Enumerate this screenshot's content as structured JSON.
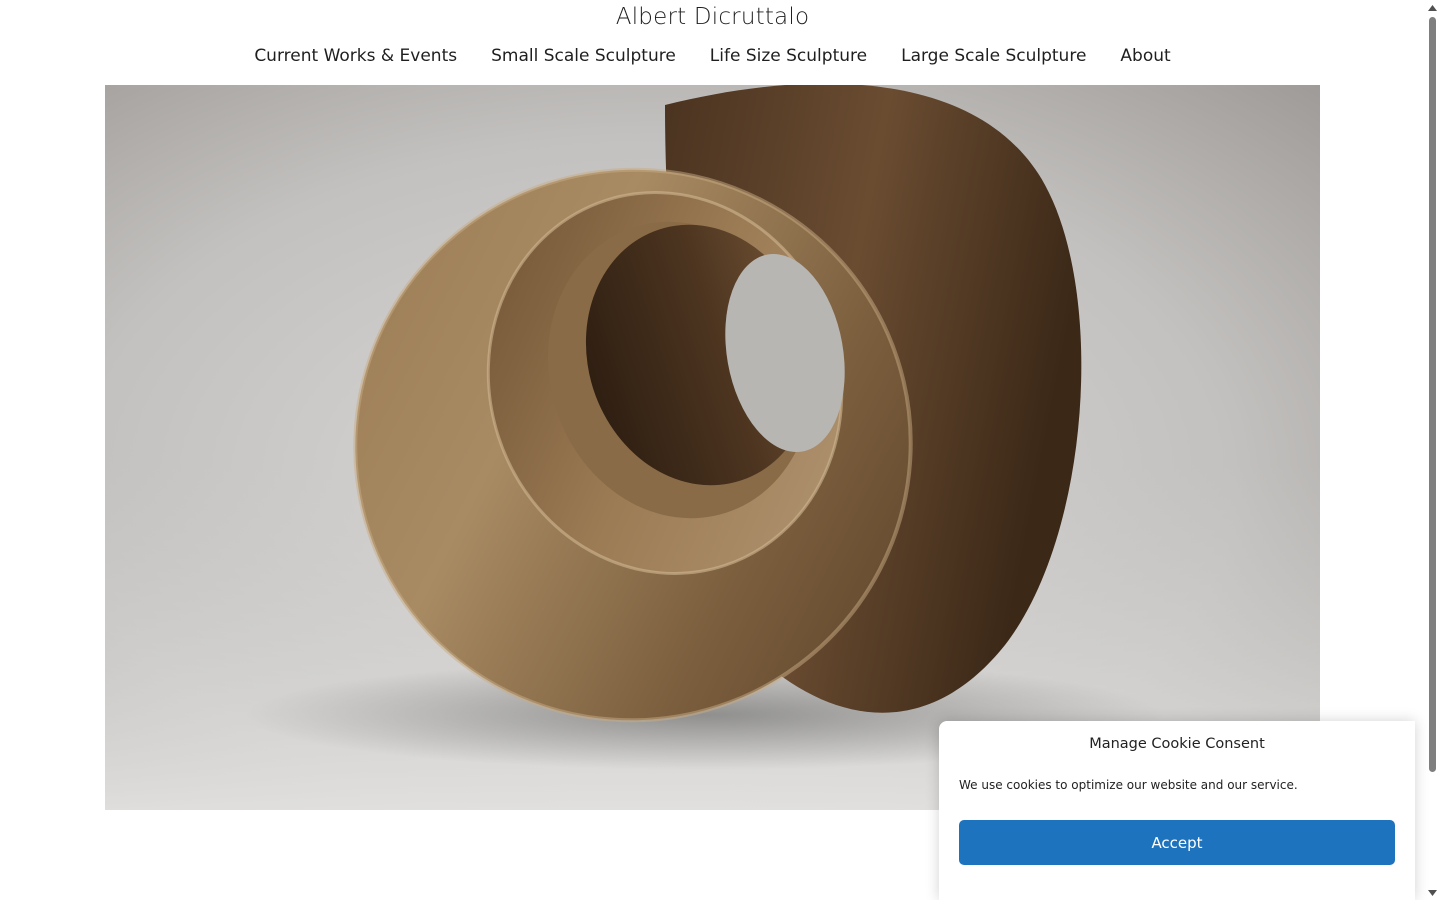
{
  "site": {
    "title": "Albert Dicruttalo"
  },
  "nav": {
    "items": [
      {
        "label": "Current Works & Events"
      },
      {
        "label": "Small Scale Sculpture"
      },
      {
        "label": "Life Size Sculpture"
      },
      {
        "label": "Large Scale Sculpture"
      },
      {
        "label": "About"
      }
    ]
  },
  "cookie": {
    "title": "Manage Cookie Consent",
    "text": "We use cookies to optimize our website and our service.",
    "accept_label": "Accept",
    "accent_color": "#1e73be"
  },
  "hero": {
    "subject": "bronze ring sculpture photo"
  },
  "icons": {
    "scroll_up": "chevron-up-icon",
    "scroll_down": "chevron-down-icon"
  }
}
